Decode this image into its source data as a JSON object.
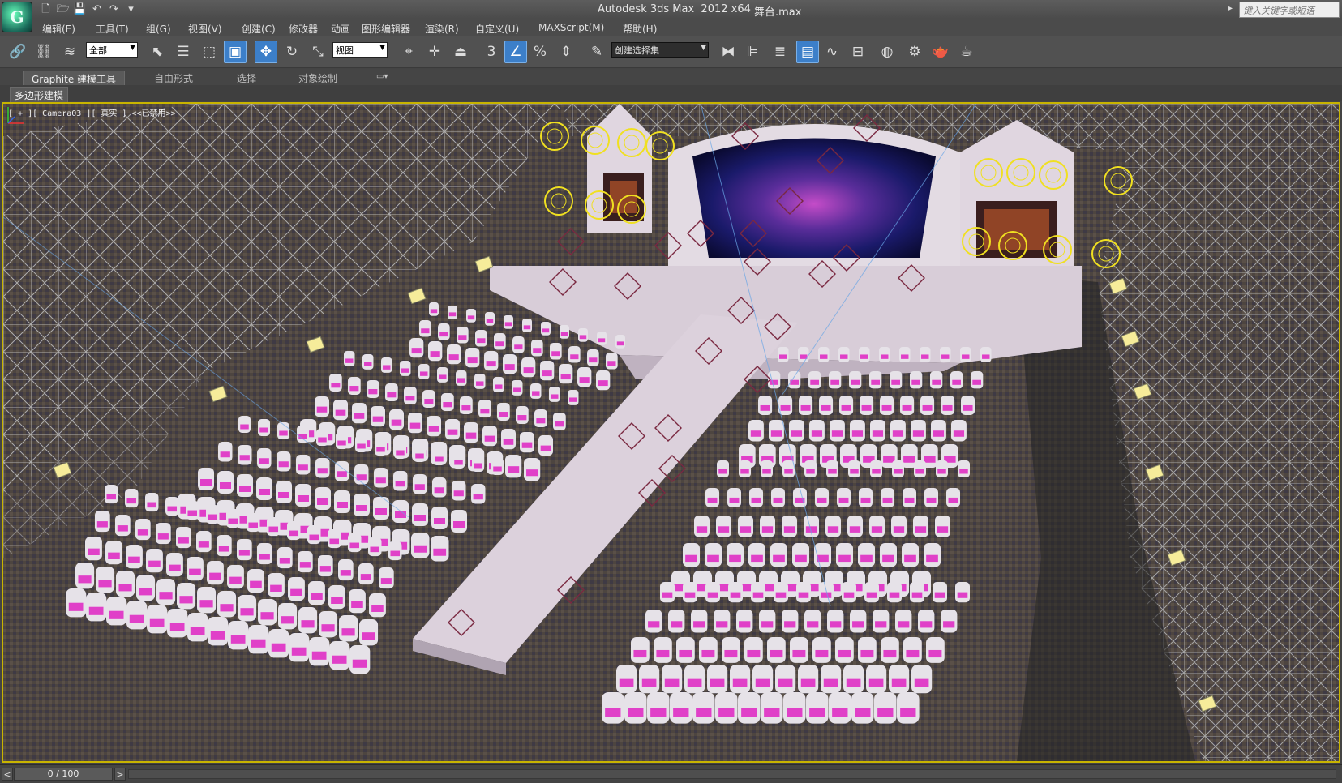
{
  "title_bar": {
    "app_title": "Autodesk 3ds Max  2012 x64",
    "file_name": "舞台.max",
    "search_placeholder": "键入关键字或短语",
    "logo_glyph": "G"
  },
  "quick_access": [
    {
      "icon": "new-file-icon",
      "glyph": "🗋"
    },
    {
      "icon": "open-file-icon",
      "glyph": "🗁"
    },
    {
      "icon": "save-icon",
      "glyph": "💾"
    },
    {
      "icon": "undo-icon",
      "glyph": "↶"
    },
    {
      "icon": "redo-icon",
      "glyph": "↷"
    },
    {
      "icon": "customize-dropdown-icon",
      "glyph": "▾"
    }
  ],
  "menu": [
    {
      "label": "编辑(E)"
    },
    {
      "label": "工具(T)"
    },
    {
      "label": "组(G)"
    },
    {
      "label": "视图(V)"
    },
    {
      "label": "创建(C)"
    },
    {
      "label": "修改器"
    },
    {
      "label": "动画"
    },
    {
      "label": "图形编辑器"
    },
    {
      "label": "渲染(R)"
    },
    {
      "label": "自定义(U)"
    },
    {
      "label": "MAXScript(M)"
    },
    {
      "label": "帮助(H)"
    }
  ],
  "toolbar": {
    "selection_filter": "全部",
    "reference_coord": "视图",
    "named_selection": "创建选择集",
    "buttons": [
      {
        "icon": "link-icon",
        "glyph": "🔗"
      },
      {
        "icon": "unlink-icon",
        "glyph": "⛓"
      },
      {
        "icon": "bind-space-warp-icon",
        "glyph": "≋"
      },
      {
        "icon": "select-object-icon",
        "glyph": "⬉"
      },
      {
        "icon": "select-by-name-icon",
        "glyph": "☰"
      },
      {
        "icon": "rectangular-selection-icon",
        "glyph": "⬚"
      },
      {
        "icon": "window-crossing-icon",
        "glyph": "▣"
      },
      {
        "icon": "select-move-icon",
        "glyph": "✥"
      },
      {
        "icon": "select-rotate-icon",
        "glyph": "↻"
      },
      {
        "icon": "select-scale-icon",
        "glyph": "⤡"
      },
      {
        "icon": "pivot-center-icon",
        "glyph": "⌖"
      },
      {
        "icon": "select-manipulate-icon",
        "glyph": "✛"
      },
      {
        "icon": "keyboard-shortcut-override-icon",
        "glyph": "⏏"
      },
      {
        "icon": "snaps-toggle-icon",
        "glyph": "3"
      },
      {
        "icon": "angle-snap-icon",
        "glyph": "∠"
      },
      {
        "icon": "percent-snap-icon",
        "glyph": "%"
      },
      {
        "icon": "spinner-snap-icon",
        "glyph": "⇕"
      },
      {
        "icon": "edit-named-selection-icon",
        "glyph": "✎"
      },
      {
        "icon": "mirror-icon",
        "glyph": "⧓"
      },
      {
        "icon": "align-icon",
        "glyph": "⊫"
      },
      {
        "icon": "layer-manager-icon",
        "glyph": "≣"
      },
      {
        "icon": "graphite-toggle-icon",
        "glyph": "▤"
      },
      {
        "icon": "curve-editor-icon",
        "glyph": "∿"
      },
      {
        "icon": "schematic-view-icon",
        "glyph": "⊟"
      },
      {
        "icon": "material-editor-icon",
        "glyph": "◍"
      },
      {
        "icon": "render-setup-icon",
        "glyph": "⚙"
      },
      {
        "icon": "rendered-frame-window-icon",
        "glyph": "🫖"
      },
      {
        "icon": "render-production-icon",
        "glyph": "☕"
      }
    ]
  },
  "ribbon": {
    "tabs": [
      {
        "label": "Graphite 建模工具"
      },
      {
        "label": "自由形式"
      },
      {
        "label": "选择"
      },
      {
        "label": "对象绘制"
      }
    ],
    "panel_label": "多边形建模"
  },
  "viewport": {
    "label": "[ + ][ Camera03 ][ 真实 ] <<已禁用>>",
    "border_color": "#c8b400",
    "chair_pink": "#e040c8",
    "stage_color": "#d8cdd8",
    "light_yellow": "#f0e020",
    "truss_color": "#b8b8b8"
  },
  "timeline": {
    "frame_display": "0 / 100",
    "prev_glyph": "<",
    "next_glyph": ">"
  }
}
